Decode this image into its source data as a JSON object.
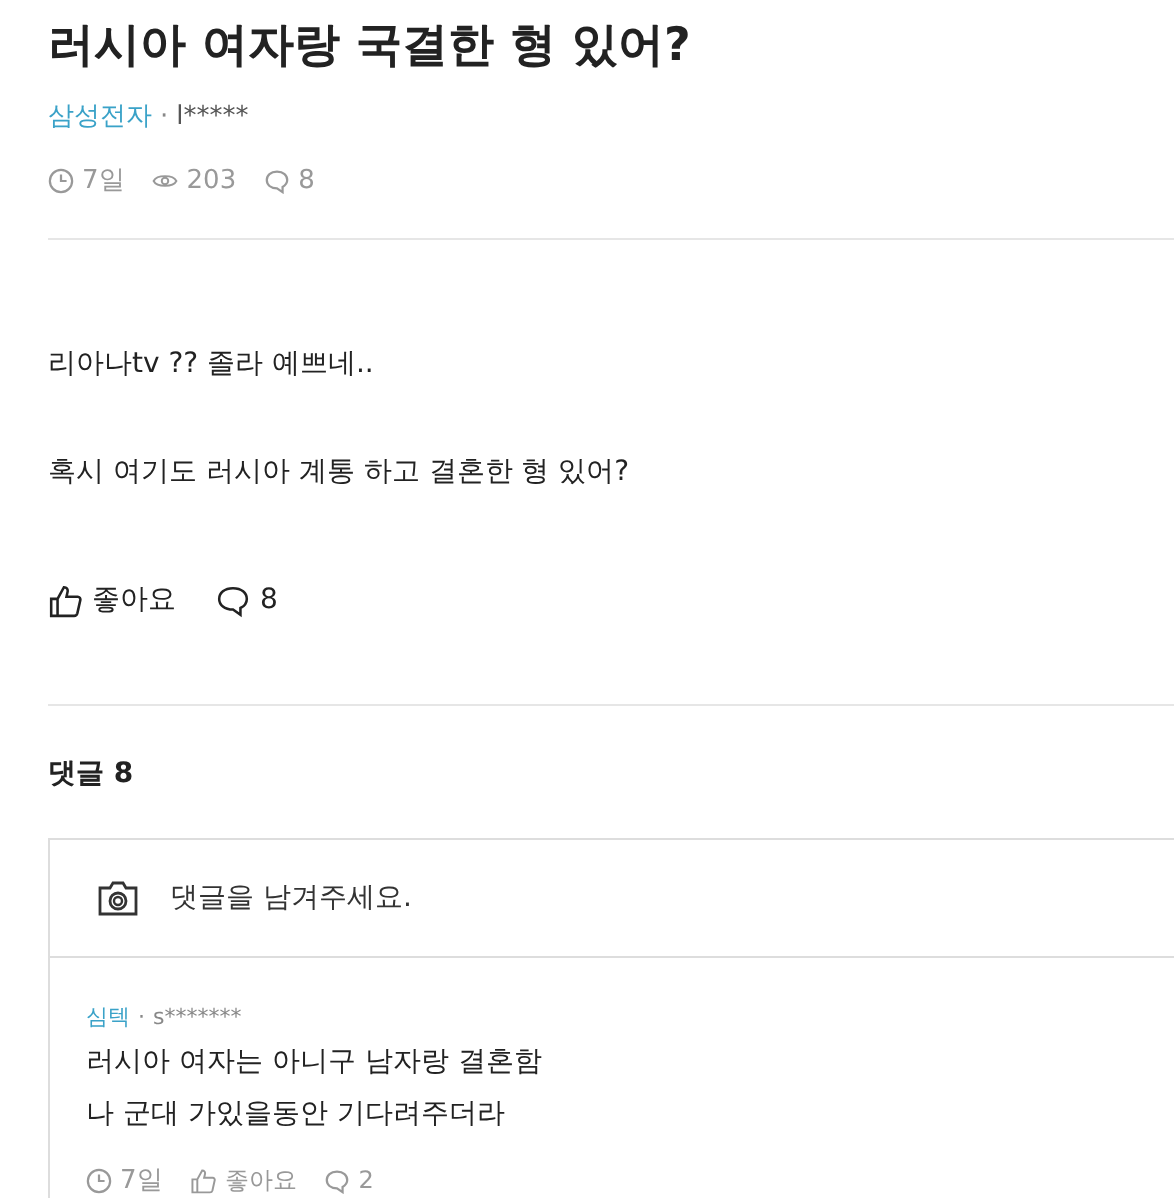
{
  "post": {
    "title": "러시아 여자랑 국결한 형 있어?",
    "company": "삼성전자",
    "separator": "·",
    "author": "l*****",
    "time": "7일",
    "views": "203",
    "comments": "8",
    "body": [
      "리아나tv ?? 졸라 예쁘네..",
      "혹시 여기도 러시아 계통 하고 결혼한 형 있어?"
    ],
    "like_label": "좋아요",
    "comment_count": "8"
  },
  "comments_section": {
    "heading": "댓글 8",
    "input": {
      "placeholder": "댓글을 남겨주세요."
    },
    "comments": [
      {
        "company": "심텍",
        "separator": "·",
        "author": "s*******",
        "lines": [
          "러시아 여자는 아니구 남자랑 결혼함",
          "나 군대 가있을동안 기다려주더라"
        ],
        "time": "7일",
        "like_label": "좋아요",
        "replies": "2"
      }
    ]
  }
}
